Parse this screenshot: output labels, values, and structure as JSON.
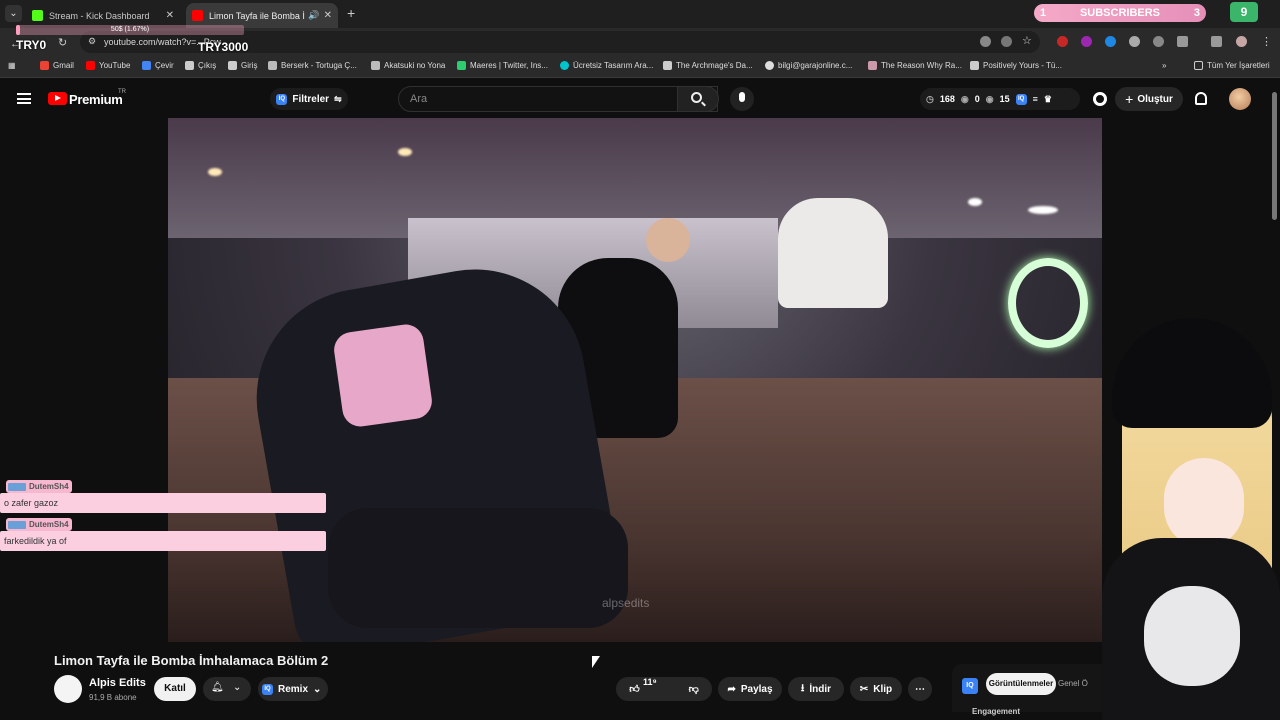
{
  "browser": {
    "tabs": [
      {
        "title": "Stream - Kick Dashboard",
        "favicon_color": "#53fc18"
      },
      {
        "title": "Limon Tayfa ile Bomba İmha",
        "favicon_color": "#ff0000",
        "active": true
      }
    ],
    "url": "youtube.com/watch?v=...Pcw",
    "bookmarks": [
      {
        "label": "Gmail",
        "icon": "gmail-icon"
      },
      {
        "label": "YouTube",
        "icon": "youtube-icon"
      },
      {
        "label": "Çevir",
        "icon": "translate-icon"
      },
      {
        "label": "Çıkış",
        "icon": "page-icon"
      },
      {
        "label": "Giriş",
        "icon": "page-icon"
      },
      {
        "label": "Berserk - Tortuga Ç...",
        "icon": "cloud-icon"
      },
      {
        "label": "Akatsuki no Yona",
        "icon": "star-icon"
      },
      {
        "label": "Maeres | Twitter, Ins...",
        "icon": "green-icon"
      },
      {
        "label": "Ücretsiz Tasarım Ara...",
        "icon": "canva-icon"
      },
      {
        "label": "The Archmage's Da...",
        "icon": "page-icon"
      },
      {
        "label": "bilgi@garajonline.c...",
        "icon": "globe-icon"
      },
      {
        "label": "The Reason Why Ra...",
        "icon": "page-icon"
      },
      {
        "label": "Positively Yours - Tü...",
        "icon": "page-icon"
      }
    ],
    "all_bookmarks": "Tüm Yer İşaretleri"
  },
  "stream_overlay": {
    "goal_left": "TRY0",
    "goal_right": "TRY3000",
    "goal_progress_text": "50$ (1.67%)",
    "goal_progress": 0.0167,
    "subs_left": "1",
    "subs_label": "SUBSCRIBERS",
    "subs_right": "3",
    "counter": "9",
    "chat": [
      {
        "user": "DutemSh4",
        "message": "o zafer gazoz"
      },
      {
        "user": "DutemSh4",
        "message": "farkedildik ya of"
      }
    ]
  },
  "youtube": {
    "brand": "Premium",
    "country": "TR",
    "filters_label": "Filtreler",
    "search_placeholder": "Ara",
    "stats": {
      "views": "168",
      "a": "0",
      "b": "15"
    },
    "create_label": "Oluştur",
    "video": {
      "title": "Limon Tayfa ile Bomba İmhalamaca Bölüm 2",
      "watermark": "alpsedits",
      "channel": "Alpis Edits",
      "subscribers": "91,9 B abone",
      "join_label": "Katıl",
      "remix_label": "Remix",
      "likes": "11⁹",
      "share_label": "Paylaş",
      "download_label": "İndir",
      "clip_label": "Klip"
    },
    "side_panel": {
      "views_tab": "Görüntülenmeler",
      "general_tab": "Genel Ö",
      "engagement": "Engagement"
    }
  }
}
